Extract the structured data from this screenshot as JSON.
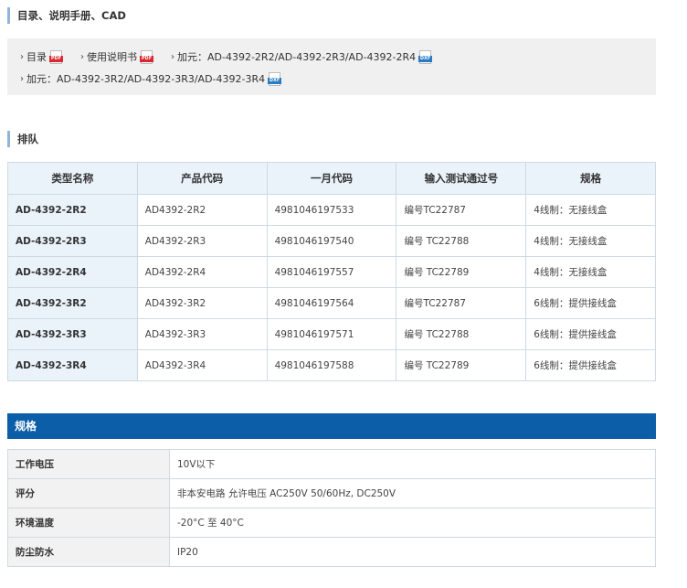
{
  "sections": {
    "docs_title": "目录、说明手册、CAD",
    "lineup_title": "排队",
    "specs_title": "规格"
  },
  "docs": {
    "row1": [
      {
        "label": "目录",
        "file_type": "PDF"
      },
      {
        "label": "使用说明书",
        "file_type": "PDF"
      },
      {
        "label": "加元：AD-4392-2R2/AD-4392-2R3/AD-4392-2R4",
        "file_type": "DXF"
      }
    ],
    "row2": [
      {
        "label": "加元：AD-4392-3R2/AD-4392-3R3/AD-4392-3R4",
        "file_type": "DXF"
      }
    ],
    "chevron_icon": "chevron-right-icon"
  },
  "lineup": {
    "headers": [
      "类型名称",
      "产品代码",
      "一月代码",
      "输入测试通过号",
      "规格"
    ],
    "rows": [
      [
        "AD-4392-2R2",
        "AD4392-2R2",
        "4981046197533",
        "编号TC22787",
        "4线制：无接线盒"
      ],
      [
        "AD-4392-2R3",
        "AD4392-2R3",
        "4981046197540",
        "编号 TC22788",
        "4线制：无接线盒"
      ],
      [
        "AD-4392-2R4",
        "AD4392-2R4",
        "4981046197557",
        "编号 TC22789",
        "4线制：无接线盒"
      ],
      [
        "AD-4392-3R2",
        "AD4392-3R2",
        "4981046197564",
        "编号TC22787",
        "6线制：提供接线盒"
      ],
      [
        "AD-4392-3R3",
        "AD4392-3R3",
        "4981046197571",
        "编号 TC22788",
        "6线制：提供接线盒"
      ],
      [
        "AD-4392-3R4",
        "AD4392-3R4",
        "4981046197588",
        "编号 TC22789",
        "6线制：提供接线盒"
      ]
    ]
  },
  "specs": {
    "rows": [
      {
        "key": "工作电压",
        "value": "10V以下"
      },
      {
        "key": "评分",
        "value": "非本安电路 允许电压 AC250V 50/60Hz, DC250V"
      },
      {
        "key": "环境温度",
        "value": "-20°C 至 40°C"
      },
      {
        "key": "防尘防水",
        "value": "IP20"
      }
    ]
  },
  "colors": {
    "accent_bar": "#0c5ea8",
    "section_marker": "#8eb4d9",
    "table_header_bg": "#eaf2fa",
    "pdf_icon": "#d9282f",
    "dxf_icon": "#2a7cc2"
  }
}
